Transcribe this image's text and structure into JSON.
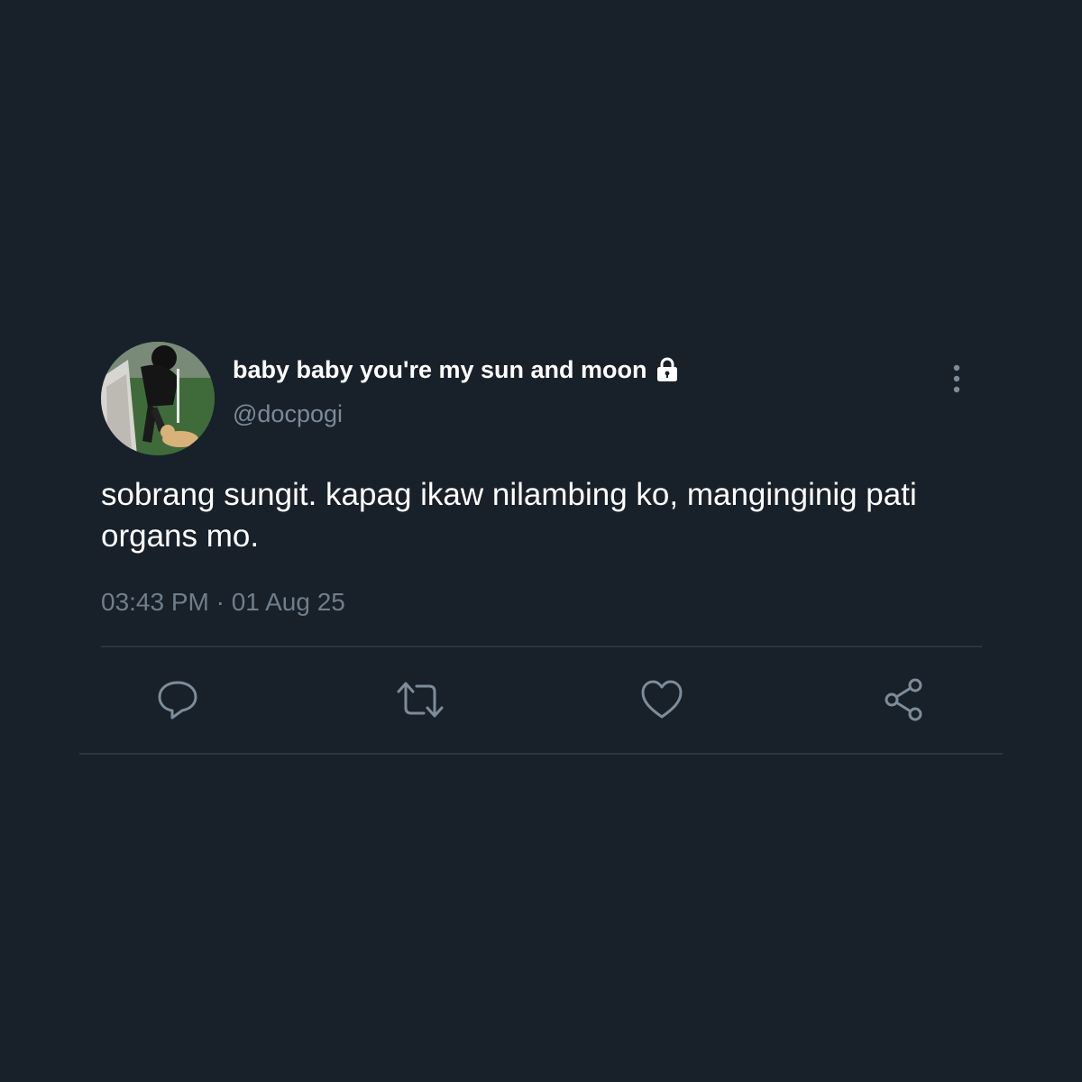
{
  "tweet": {
    "display_name": "baby baby you're my sun and moon",
    "handle": "@docpogi",
    "text": "sobrang sungit. kapag ikaw nilambing ko, manginginig pati organs mo.",
    "timestamp": "03:43 PM · 01 Aug 25",
    "verified_lock": true
  },
  "icons": {
    "avatar": "profile-photo",
    "lock": "lock-icon",
    "more": "more-vertical-icon",
    "reply": "reply-icon",
    "retweet": "retweet-icon",
    "like": "heart-icon",
    "share": "share-icon"
  },
  "colors": {
    "background": "#18202a",
    "primary_text": "#ffffff",
    "secondary_text": "#6f7e8c",
    "icon": "#7d8c99",
    "divider": "#2b3540"
  }
}
